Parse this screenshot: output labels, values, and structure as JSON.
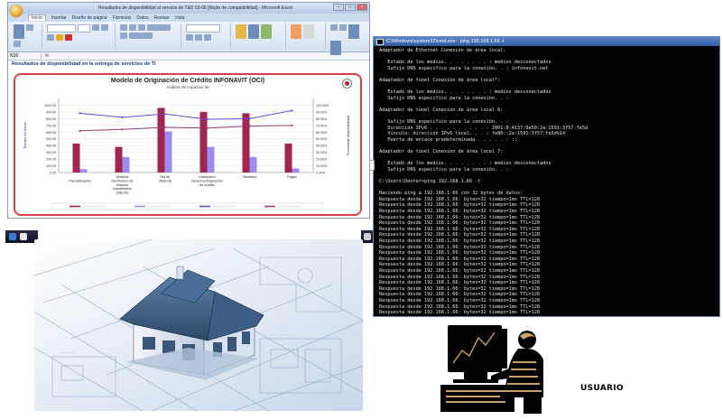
{
  "excel": {
    "title": "Resultados de disponibilidad al servicio de T&D 03-06 [Modo de compatibilidad] - Microsoft Excel",
    "tabs": [
      "Inicio",
      "Insertar",
      "Diseño de página",
      "Fórmulas",
      "Datos",
      "Revisar",
      "Vista"
    ],
    "name_box": "N16",
    "sheet_heading": "Resultados de disponibilidad en la entrega de servicios de TI",
    "colors": {
      "titlebar": "#b7c9e6",
      "ribbon": "#d6e2f2",
      "chart_border": "#d9404a"
    }
  },
  "chart_data": {
    "type": "bar",
    "title": "Modelo de Originación de Crédito INFONAVIT (OCI)",
    "subtitle": "Análisis de impactos de",
    "ylabel": "Tiempo en horas",
    "y2label": "Porcentaje disponibilidad",
    "categories": [
      "Precalificación",
      "Sistema Electrónico de Avalúos Inmobiliarios (SELAI)",
      "Tarj de Vivienda",
      "Inscripción Derecho/Originación de crédito",
      "Titulación",
      "Pagos"
    ],
    "ylim": [
      0,
      1100
    ],
    "y_ticks": [
      "0.00",
      "100.00",
      "200.00",
      "300.00",
      "400.00",
      "500.00",
      "600.00",
      "700.00",
      "800.00",
      "900.00",
      "1000.00"
    ],
    "y2lim": [
      0,
      110
    ],
    "y2_ticks": [
      "0.00%",
      "10.00%",
      "20.00%",
      "30.00%",
      "40.00%",
      "50.00%",
      "60.00%",
      "70.00%",
      "80.00%",
      "90.00%",
      "100.00%"
    ],
    "series": [
      {
        "kind": "bar",
        "values": [
          430,
          380,
          960,
          900,
          880,
          430
        ],
        "color": "#a3244f"
      },
      {
        "kind": "bar",
        "values": [
          50,
          230,
          610,
          380,
          230,
          60
        ],
        "color": "#9a8cf0"
      },
      {
        "kind": "line",
        "axis": "right",
        "values": [
          88,
          82,
          87,
          79,
          80,
          92
        ],
        "color": "#6a4cd8"
      },
      {
        "kind": "line",
        "axis": "right",
        "values": [
          62,
          64,
          67,
          66,
          69,
          70
        ],
        "color": "#9a3a6e"
      }
    ],
    "legend_placement": "bottom",
    "colors": {
      "bar_a": "#a3244f",
      "bar_b": "#9a8cf0",
      "line_a": "#6a4cd8",
      "line_b": "#9a3a6e"
    }
  },
  "cmd": {
    "title": "C:\\Windows\\system32\\cmd.exe - ping 192.168.1.66 -t",
    "lines": [
      "Adaptador de Ethernet Conexión de área local:",
      "",
      "   Estado de los medios. . . . . . . . : medios desconectados",
      "   Sufijo DNS específico para la conexión. . : infonavit.net",
      "",
      "Adaptador de túnel Conexión de área local*:",
      "",
      "   Estado de los medios. . . . . . . . : medios desconectados",
      "   Sufijo DNS específico para la conexión. . :",
      "",
      "Adaptador de túnel Conexión de área local 6:",
      "",
      "   Sufijo DNS específico para la conexión. . :",
      "   Dirección IPv6 . . . . . . . . . . : 2001:0:4137:9e50:2a:1591:3f57:fe5d",
      "   Vínculo: dirección IPv6 local. . . : fe80::2a:1591:3f57:fe5d%14",
      "   Puerta de enlace predeterminada . . . . . : ::",
      "",
      "Adaptador de túnel Conexión de área local 7:",
      "",
      "   Estado de los medios. . . . . . . . : medios desconectados",
      "   Sufijo DNS específico para la conexión. . :",
      "",
      "C:\\Users\\Dexter>ping 192.168.1.66 -t",
      "",
      "Haciendo ping a 192.168.1.66 con 32 bytes de datos:",
      "Respuesta desde 192.168.1.66: bytes=32 tiempo=1ms TTL=128",
      "Respuesta desde 192.168.1.66: bytes=32 tiempo=1ms TTL=128",
      "Respuesta desde 192.168.1.66: bytes=32 tiempo=1ms TTL=128",
      "Respuesta desde 192.168.1.66: bytes=32 tiempo=1ms TTL=128",
      "Respuesta desde 192.168.1.66: bytes=32 tiempo=1ms TTL=128",
      "Respuesta desde 192.168.1.66: bytes=32 tiempo=1ms TTL=128",
      "Respuesta desde 192.168.1.66: bytes=32 tiempo=1ms TTL=128",
      "Respuesta desde 192.168.1.66: bytes=32 tiempo=1ms TTL=128",
      "Respuesta desde 192.168.1.66: bytes=32 tiempo=1ms TTL=128",
      "Respuesta desde 192.168.1.66: bytes=32 tiempo=1ms TTL=128",
      "Respuesta desde 192.168.1.66: bytes=32 tiempo=1ms TTL=128",
      "Respuesta desde 192.168.1.66: bytes=32 tiempo=1ms TTL=128",
      "Respuesta desde 192.168.1.66: bytes=32 tiempo=1ms TTL=128",
      "Respuesta desde 192.168.1.66: bytes=32 tiempo=1ms TTL=128",
      "Respuesta desde 192.168.1.66: bytes=32 tiempo=1ms TTL=128",
      "Respuesta desde 192.168.1.66: bytes=32 tiempo=1ms TTL=128",
      "Respuesta desde 192.168.1.66: bytes=32 tiempo=1ms TTL=128",
      "Respuesta desde 192.168.1.66: bytes=32 tiempo=1ms TTL=128",
      "Respuesta desde 192.168.1.66: bytes=32 tiempo=1ms TTL=128",
      "Respuesta desde 192.168.1.66: bytes=32 tiempo=1ms TTL=128"
    ]
  },
  "user": {
    "label": "USUARIO"
  }
}
